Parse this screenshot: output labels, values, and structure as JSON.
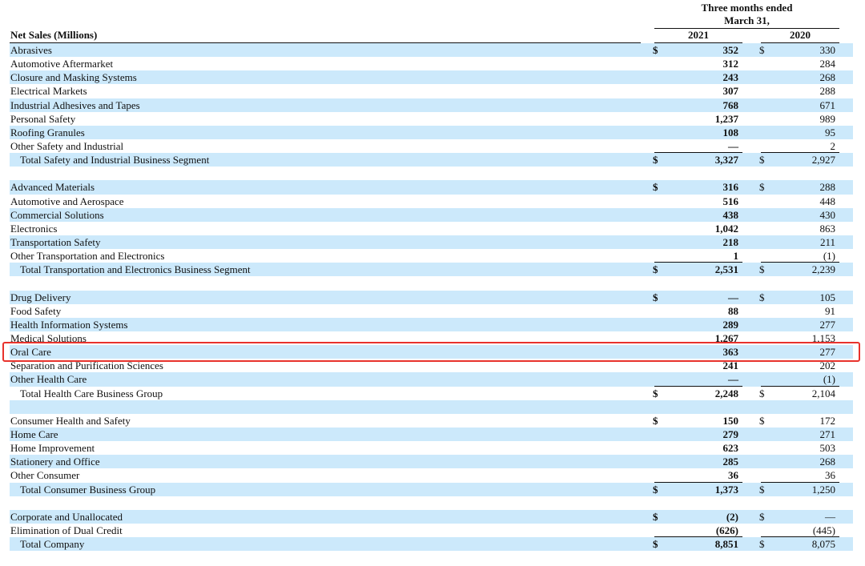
{
  "header": {
    "period_line1": "Three months ended",
    "period_line2": "March 31,",
    "year_current": "2021",
    "year_prior": "2020",
    "table_title": "Net Sales (Millions)"
  },
  "currency_symbol": "$",
  "rows": [
    {
      "label": "Abrasives",
      "v2021": "352",
      "v2020": "330",
      "dollar": true,
      "type": "item"
    },
    {
      "label": "Automotive Aftermarket",
      "v2021": "312",
      "v2020": "284",
      "type": "item"
    },
    {
      "label": "Closure and Masking Systems",
      "v2021": "243",
      "v2020": "268",
      "type": "item"
    },
    {
      "label": "Electrical Markets",
      "v2021": "307",
      "v2020": "288",
      "type": "item"
    },
    {
      "label": "Industrial Adhesives and Tapes",
      "v2021": "768",
      "v2020": "671",
      "type": "item"
    },
    {
      "label": "Personal Safety",
      "v2021": "1,237",
      "v2020": "989",
      "type": "item"
    },
    {
      "label": "Roofing Granules",
      "v2021": "108",
      "v2020": "95",
      "type": "item"
    },
    {
      "label": "Other Safety and Industrial",
      "v2021": "—",
      "v2020": "2",
      "type": "item"
    },
    {
      "label": "Total Safety and Industrial Business Segment",
      "v2021": "3,327",
      "v2020": "2,927",
      "dollar": true,
      "type": "total"
    },
    {
      "type": "blank"
    },
    {
      "label": "Advanced Materials",
      "v2021": "316",
      "v2020": "288",
      "dollar": true,
      "type": "item"
    },
    {
      "label": "Automotive and Aerospace",
      "v2021": "516",
      "v2020": "448",
      "type": "item"
    },
    {
      "label": "Commercial Solutions",
      "v2021": "438",
      "v2020": "430",
      "type": "item"
    },
    {
      "label": "Electronics",
      "v2021": "1,042",
      "v2020": "863",
      "type": "item"
    },
    {
      "label": "Transportation Safety",
      "v2021": "218",
      "v2020": "211",
      "type": "item"
    },
    {
      "label": "Other Transportation and Electronics",
      "v2021": "1",
      "v2020": "(1)",
      "type": "item"
    },
    {
      "label": "Total Transportation and Electronics Business Segment",
      "v2021": "2,531",
      "v2020": "2,239",
      "dollar": true,
      "type": "total"
    },
    {
      "type": "blank"
    },
    {
      "label": "Drug Delivery",
      "v2021": "—",
      "v2020": "105",
      "dollar": true,
      "type": "item"
    },
    {
      "label": "Food Safety",
      "v2021": "88",
      "v2020": "91",
      "type": "item"
    },
    {
      "label": "Health Information Systems",
      "v2021": "289",
      "v2020": "277",
      "type": "item"
    },
    {
      "label": "Medical Solutions",
      "v2021": "1,267",
      "v2020": "1,153",
      "type": "item"
    },
    {
      "label": "Oral Care",
      "v2021": "363",
      "v2020": "277",
      "type": "item",
      "highlighted": true
    },
    {
      "label": "Separation and Purification Sciences",
      "v2021": "241",
      "v2020": "202",
      "type": "item"
    },
    {
      "label": "Other Health Care",
      "v2021": "—",
      "v2020": "(1)",
      "type": "item"
    },
    {
      "label": "Total Health Care Business Group",
      "v2021": "2,248",
      "v2020": "2,104",
      "dollar": true,
      "type": "total"
    },
    {
      "type": "blank"
    },
    {
      "label": "Consumer Health and Safety",
      "v2021": "150",
      "v2020": "172",
      "dollar": true,
      "type": "item"
    },
    {
      "label": "Home Care",
      "v2021": "279",
      "v2020": "271",
      "type": "item"
    },
    {
      "label": "Home Improvement",
      "v2021": "623",
      "v2020": "503",
      "type": "item"
    },
    {
      "label": "Stationery and Office",
      "v2021": "285",
      "v2020": "268",
      "type": "item"
    },
    {
      "label": "Other Consumer",
      "v2021": "36",
      "v2020": "36",
      "type": "item"
    },
    {
      "label": "Total Consumer Business Group",
      "v2021": "1,373",
      "v2020": "1,250",
      "dollar": true,
      "type": "total"
    },
    {
      "type": "blank"
    },
    {
      "label": "Corporate and Unallocated",
      "v2021": "(2)",
      "v2020": "—",
      "dollar": true,
      "type": "item"
    },
    {
      "label": "Elimination of Dual Credit",
      "v2021": "(626)",
      "v2020": "(445)",
      "type": "item"
    },
    {
      "label": "Total Company",
      "v2021": "8,851",
      "v2020": "8,075",
      "dollar": true,
      "type": "total"
    }
  ],
  "colors": {
    "row_stripe": "#cce9fb",
    "highlight_border": "#e8322c"
  }
}
